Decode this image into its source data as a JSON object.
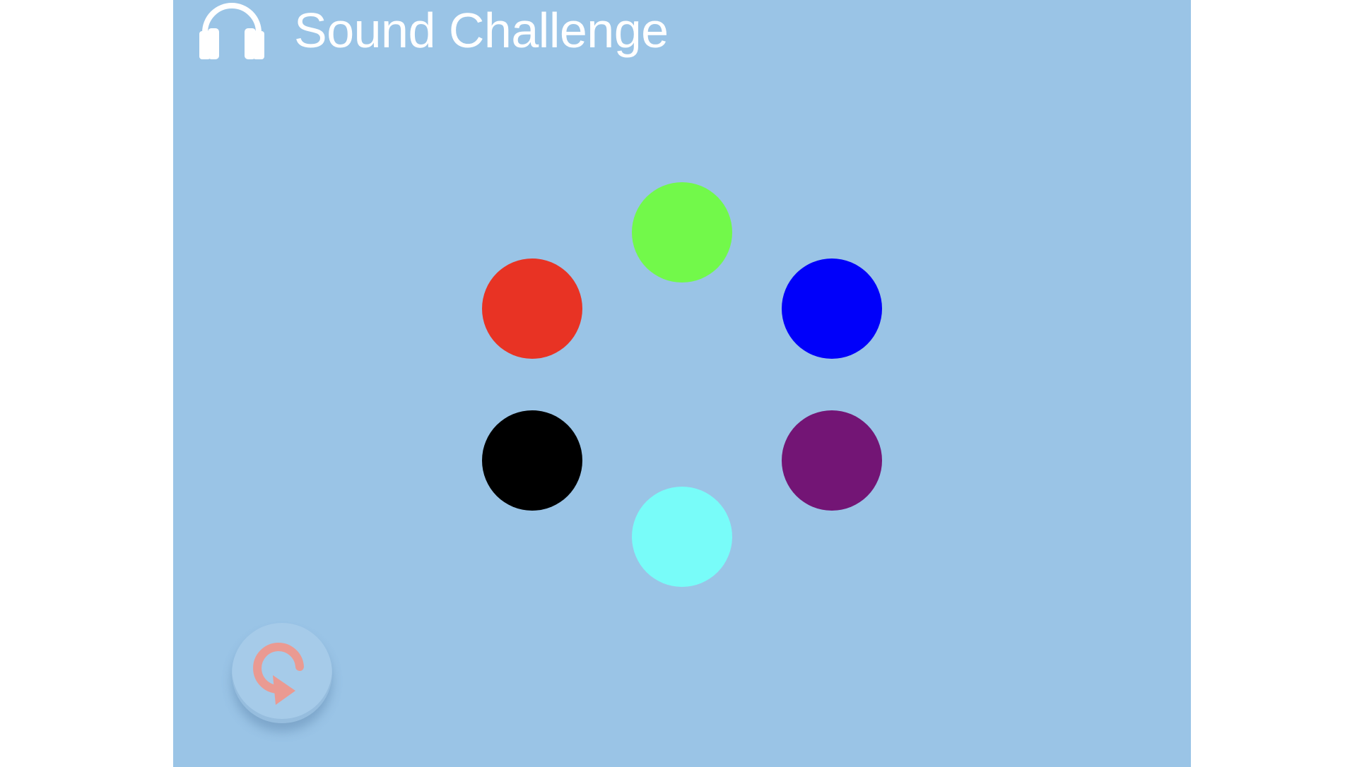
{
  "game": {
    "title": "Sound Challenge",
    "header_icon": "headphones-icon",
    "restart_icon": "restart-icon",
    "background_color": "#9ac4e6"
  },
  "pads": [
    {
      "name": "green",
      "color": "#72f94a"
    },
    {
      "name": "blue",
      "color": "#0000fa"
    },
    {
      "name": "purple",
      "color": "#731575"
    },
    {
      "name": "cyan",
      "color": "#78fcf9"
    },
    {
      "name": "black",
      "color": "#000000"
    },
    {
      "name": "red",
      "color": "#e83324"
    }
  ]
}
